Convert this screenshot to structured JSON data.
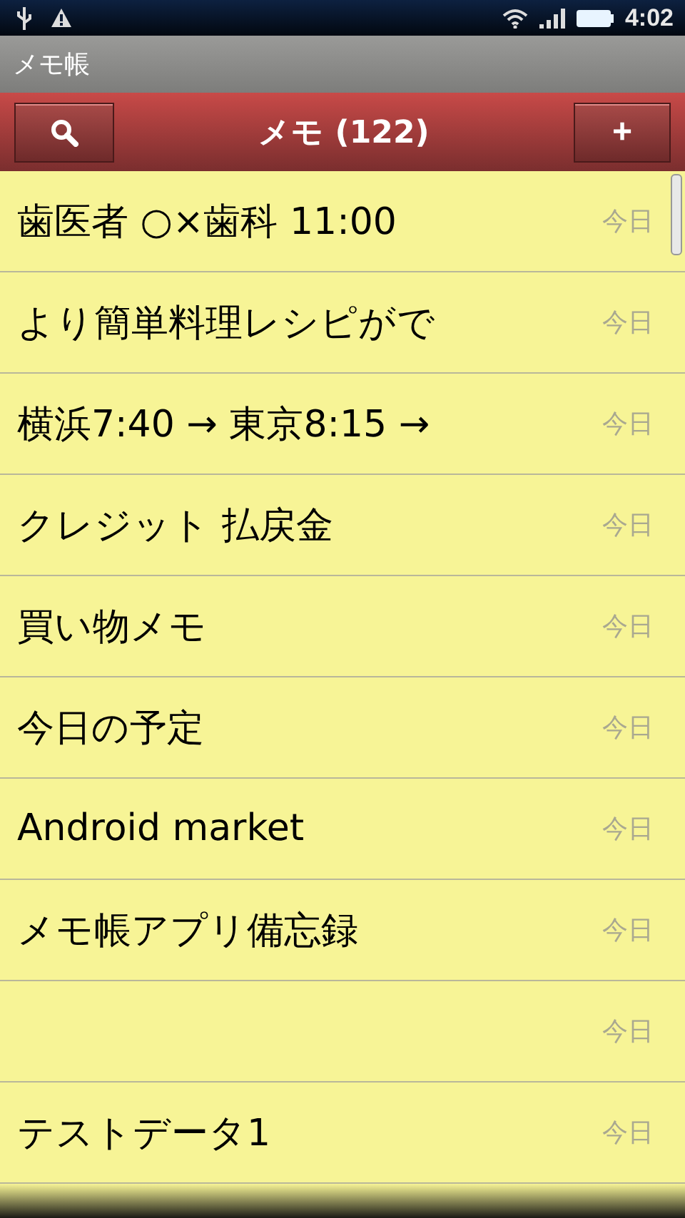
{
  "status_bar": {
    "time": "4:02"
  },
  "app_title": "メモ帳",
  "header": {
    "title": "メモ (122)",
    "add_button": "+"
  },
  "notes": [
    {
      "title": "歯医者 ○×歯科 11:00",
      "date": "今日"
    },
    {
      "title": "より簡単料理レシピがで",
      "date": "今日"
    },
    {
      "title": "横浜7:40 → 東京8:15 →",
      "date": "今日"
    },
    {
      "title": "クレジット 払戻金",
      "date": "今日"
    },
    {
      "title": "買い物メモ",
      "date": "今日"
    },
    {
      "title": "今日の予定",
      "date": "今日"
    },
    {
      "title": "Android  market",
      "date": "今日"
    },
    {
      "title": "メモ帳アプリ備忘録",
      "date": "今日"
    },
    {
      "date": "今日"
    },
    {
      "title": "テストデータ1",
      "date": "今日"
    }
  ]
}
